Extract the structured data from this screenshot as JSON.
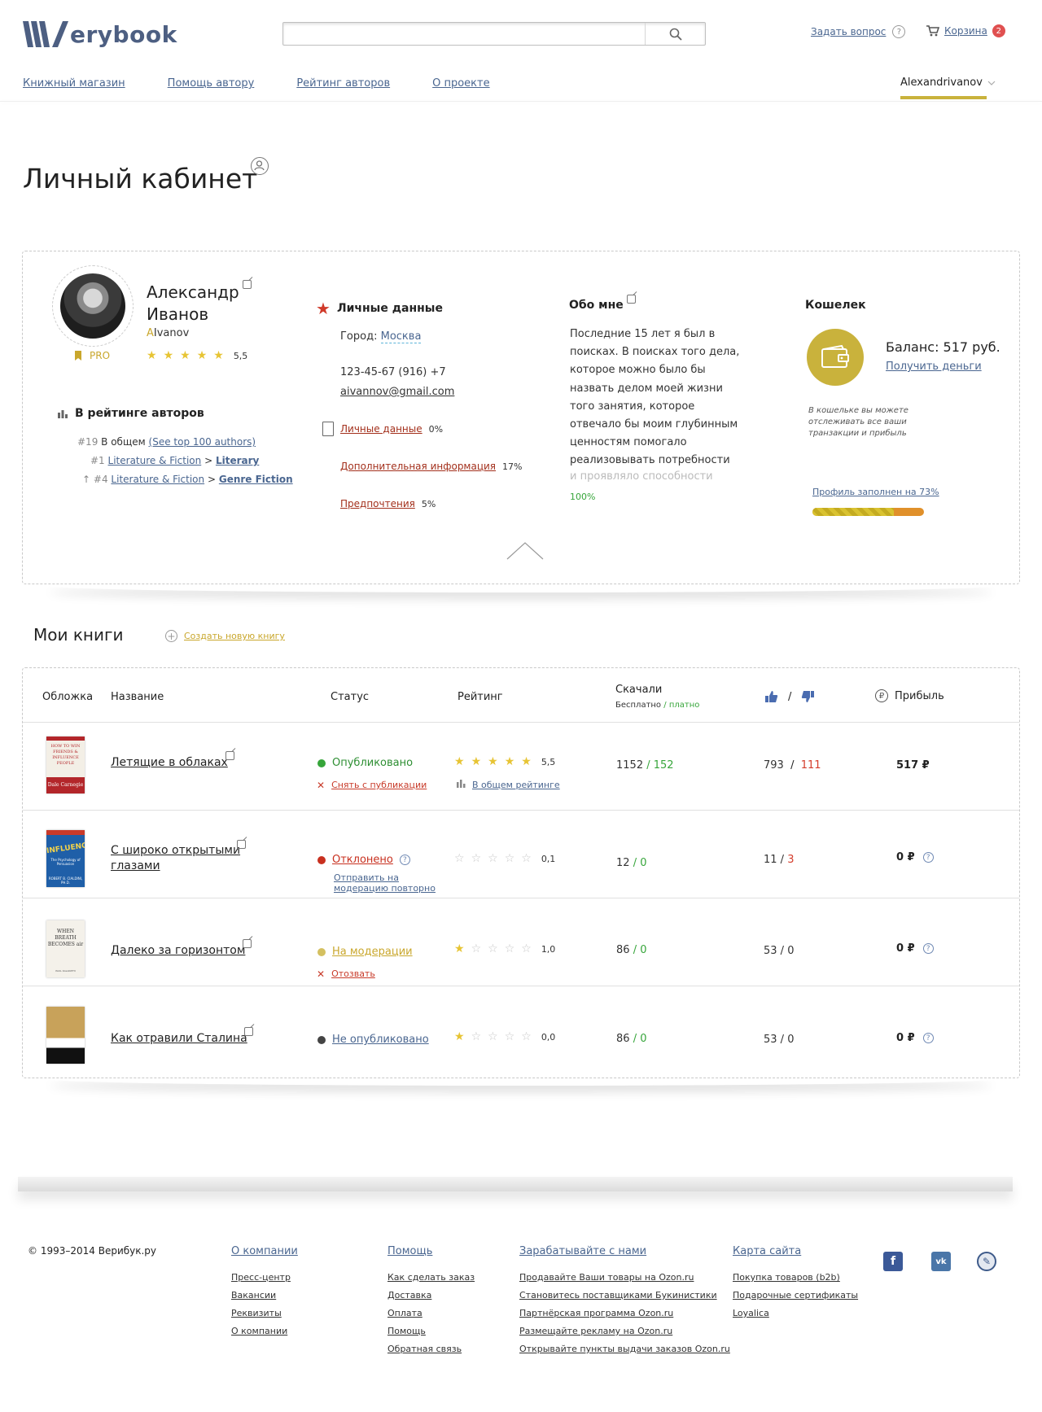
{
  "header": {
    "logo_text": "erybook",
    "search_placeholder": "",
    "ask_label": "Задать вопрос",
    "cart_label": "Корзина",
    "cart_count": "2",
    "nav": [
      "Книжный магазин",
      "Помощь автору",
      "Рейтинг авторов",
      "О проекте"
    ],
    "user_first": "A",
    "user_rest": "lexandrivanov"
  },
  "page": {
    "title": "Личный кабинет"
  },
  "profile": {
    "first_name": "Александр",
    "last_name": "Иванов",
    "login_first": "A",
    "login_rest": "Ivanov",
    "pro_label": "PRO",
    "rating_value": "5,5",
    "rating_stars": 5,
    "authors_rating_title": "В рейтинге авторов",
    "rank_overall": "#19",
    "rank_overall_label": "В общем",
    "see_top_link": "(See top 100 authors)",
    "rank_cat1": "#1",
    "cat1_parent": "Literature & Fiction",
    "cat1_child": "Literary",
    "rank_cat2": "#4",
    "cat2_parent": "Literature & Fiction",
    "cat2_child": "Genre Fiction",
    "separator": ">"
  },
  "personal": {
    "title": "Личные данные",
    "city_label": "Город:",
    "city": "Москва",
    "phone": "123-45-67 (916) +7",
    "email": "aivannov@gmail.com",
    "personal_link": "Личные данные",
    "personal_pct": "0%",
    "extra_link": "Дополнительная информация",
    "extra_pct": "17%",
    "prefs_link": "Предпочтения",
    "prefs_pct": "5%"
  },
  "about": {
    "title": "Обо мне",
    "text": "Последние 15 лет я был в поисках. В поисках того дела, которое можно было бы назвать делом моей жизни того занятия, которое отвечало бы моим глубинным ценностям помогало реализовывать потребности",
    "faded": "и проявляло способности",
    "percent": "100%"
  },
  "wallet": {
    "title": "Кошелек",
    "balance": "Баланс: 517 руб.",
    "get_money": "Получить деньги",
    "note": "В кошельке вы можете отслеживать все ваши транзакции и прибыль",
    "profile_filled": "Профиль заполнен на 73%",
    "profile_filled_fraction": 0.73
  },
  "books": {
    "title": "Мои книги",
    "create_label": "Создать новую книгу",
    "columns": {
      "cover": "Обложка",
      "name": "Название",
      "status": "Статус",
      "rating": "Рейтинг",
      "downloads": "Скачали",
      "downloads_free": "Бесплатно",
      "downloads_sep": "/",
      "downloads_paid": "платно",
      "likes_sep": "/",
      "profit": "Прибыль"
    },
    "rows": [
      {
        "name": "Летящие в облаках",
        "status": "Опубликовано",
        "action": "Снять с публикации",
        "rating_link": "В общем рейтинге",
        "stars": 5,
        "rating": "5,5",
        "free": "1152",
        "paid": "152",
        "likes": "793",
        "dislikes": "111",
        "profit": "517 ₽",
        "status_color": "#36a53a",
        "cover_title": "HOW TO WIN FRIENDS & INFLUENCE PEOPLE",
        "cover_author": "Dale Carnegie"
      },
      {
        "name": "С широко открытыми глазами",
        "status": "Отклонено",
        "action": "Отправить на модерацию повторно",
        "stars": 0,
        "rating": "0,1",
        "free": "12",
        "paid": "0",
        "likes": "11",
        "dislikes": "3",
        "profit": "0 ₽",
        "status_color": "#c8301f",
        "cover_title": "INFLUENCE",
        "cover_subtitle": "The Psychology of Persuasion",
        "cover_author": "ROBERT B. CIALDINI, PH.D."
      },
      {
        "name": "Далеко за горизонтом",
        "status": "На модерации",
        "action": "Отозвать",
        "stars": 1,
        "rating": "1,0",
        "free": "86",
        "paid": "0",
        "likes": "53",
        "dislikes": "0",
        "profit": "0 ₽",
        "status_color": "#d4c060",
        "cover_title": "WHEN BREATH BECOMES air",
        "cover_author": "PAUL KALANITHI"
      },
      {
        "name": "Как отравили Сталина",
        "status": "Не опубликовано",
        "stars": 1,
        "rating": "0,0",
        "free": "86",
        "paid": "0",
        "likes": "53",
        "dislikes": "0",
        "profit": "0 ₽",
        "status_color": "#444444"
      }
    ]
  },
  "footer": {
    "copyright": "© 1993–2014 Верибук.ру",
    "col1": {
      "head": "О компании",
      "items": [
        "Пресс-центр",
        "Вакансии",
        "Реквизиты",
        "О компании"
      ]
    },
    "col2": {
      "head": "Помощь",
      "items": [
        "Как сделать заказ",
        "Доставка",
        "Оплата",
        "Помощь",
        "Обратная связь"
      ]
    },
    "col3": {
      "head": "Зарабатывайте с нами",
      "items": [
        "Продавайте Ваши товары на Ozon.ru",
        "Становитесь поставщиками Букинистики",
        "Партнёрская программа Ozon.ru",
        "Размещайте рекламу на Ozon.ru",
        "Открывайте пункты выдачи заказов Ozon.ru"
      ]
    },
    "col4": {
      "head": "Карта сайта",
      "items": [
        "Покупка товаров (b2b)",
        "Подарочные сертификаты",
        "Loyalica"
      ]
    },
    "social": [
      "facebook-icon",
      "vk-icon",
      "livejournal-icon"
    ]
  }
}
